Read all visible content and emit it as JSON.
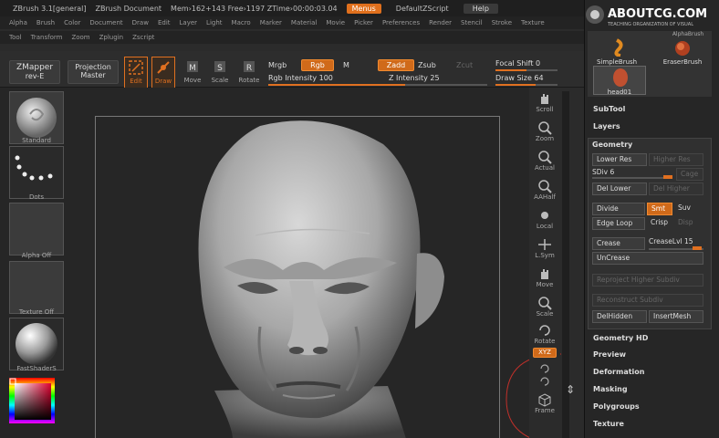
{
  "titlebar": {
    "app": "ZBrush  3.1[general]",
    "document": "ZBrush Document",
    "mem": "Mem›162+143 Free›1197 ZTime›00:00:03.04",
    "menus": "Menus",
    "default_script": "DefaultZScript",
    "help": "Help"
  },
  "menubar": [
    "Alpha",
    "Brush",
    "Color",
    "Document",
    "Draw",
    "Edit",
    "Layer",
    "Light",
    "Macro",
    "Marker",
    "Material",
    "Movie",
    "Picker",
    "Preferences",
    "Render",
    "Stencil",
    "Stroke",
    "Texture"
  ],
  "menubar2": [
    "Tool",
    "Transform",
    "Zoom",
    "Zplugin",
    "Zscript"
  ],
  "toolbar": {
    "zmapper": "ZMapper",
    "zmapper_sub": "rev-E",
    "projection": "Projection",
    "projection_sub": "Master",
    "edit": "Edit",
    "draw": "Draw",
    "move": "Move",
    "scale": "Scale",
    "rotate": "Rotate",
    "mrgb": "Mrgb",
    "rgb": "Rgb",
    "m": "M",
    "zadd": "Zadd",
    "zsub": "Zsub",
    "zcut": "Zcut",
    "rgb_intensity": "Rgb Intensity 100",
    "z_intensity": "Z Intensity 25",
    "focal_shift": "Focal Shift 0",
    "draw_size": "Draw Size 64"
  },
  "toolbar_levels": {
    "rgb_intensity": 1.0,
    "z_intensity": 0.25,
    "focal_shift": 0.5,
    "draw_size": 0.64
  },
  "left": {
    "standard": "Standard",
    "dots": "Dots",
    "alpha_off": "Alpha Off",
    "texture_off": "Texture Off",
    "material": "FastShaderS"
  },
  "shelf": [
    "Scroll",
    "Zoom",
    "Actual",
    "AAHalf",
    "Local",
    "L.Sym",
    "Move",
    "Scale",
    "Rotate",
    "Frame"
  ],
  "shelf_xyz": "XYZ",
  "logo": {
    "text": "ABOUTCG.COM",
    "sub": "TEACHING ORGANIZATION OF VISUAL"
  },
  "brushes": {
    "simple": "SimpleBrush",
    "eraser": "EraserBrush",
    "head": "head01",
    "alpha": "AlphaBrush"
  },
  "tray_top": [
    "SubTool",
    "Layers"
  ],
  "geometry": {
    "title": "Geometry",
    "lower_res": "Lower Res",
    "higher_res": "Higher Res",
    "sdiv": "SDiv 6",
    "cage": "Cage",
    "del_lower": "Del Lower",
    "del_higher": "Del Higher",
    "divide": "Divide",
    "smt": "Smt",
    "suv": "Suv",
    "edge_loop": "Edge Loop",
    "crisp": "Crisp",
    "disp": "Disp",
    "crease": "Crease",
    "crease_lvl": "CreaseLvl 15",
    "uncrease": "UnCrease",
    "reproject": "Reproject Higher Subdiv",
    "reconstruct": "Reconstruct Subdiv",
    "delhidden": "DelHidden",
    "insertmesh": "InsertMesh"
  },
  "tray_bottom": [
    "Geometry HD",
    "Preview",
    "Deformation",
    "Masking",
    "Polygroups",
    "Texture"
  ],
  "colors": {
    "accent": "#e0701d",
    "panel": "#262626",
    "button": "#3b3b3b"
  }
}
